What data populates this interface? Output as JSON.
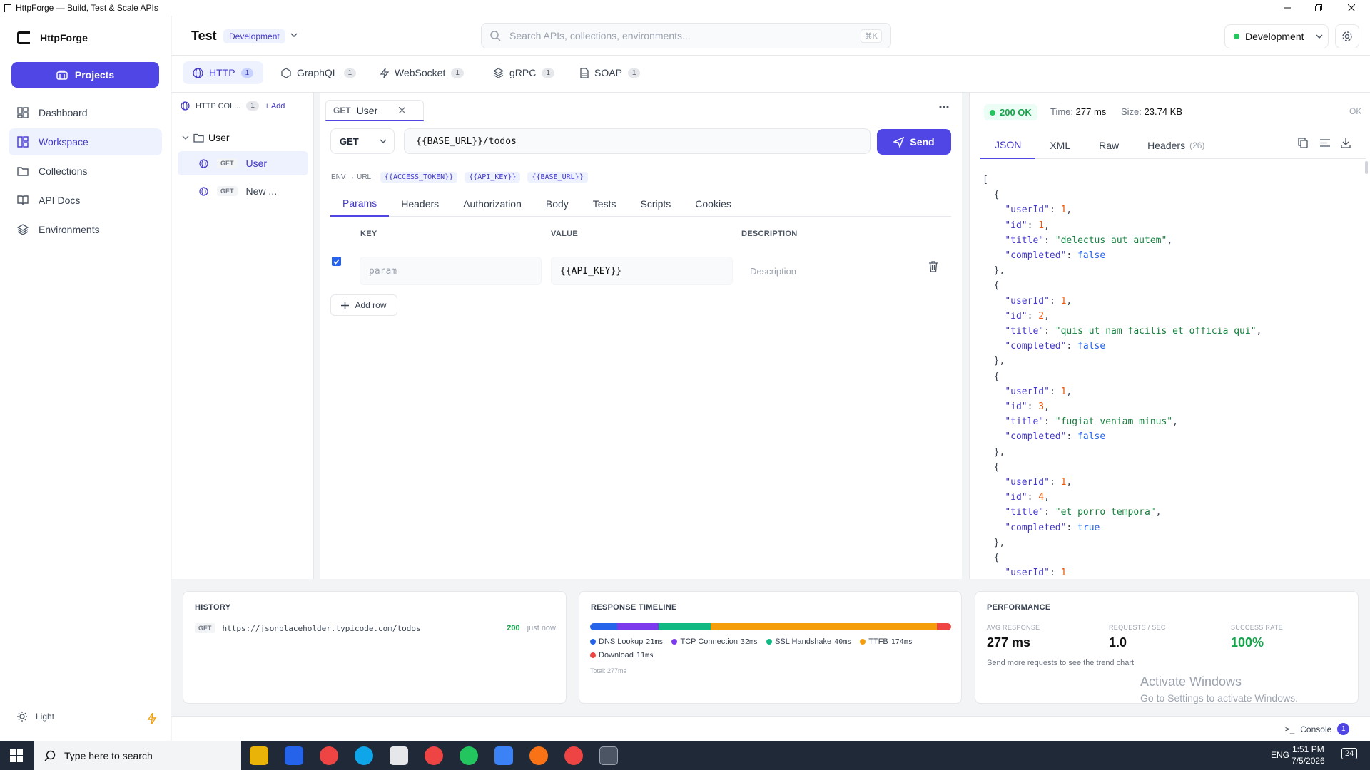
{
  "window": {
    "title": "HttpForge — Build, Test & Scale APIs"
  },
  "sidebar": {
    "brand": "HttpForge",
    "projects_label": "Projects",
    "items": [
      {
        "label": "Dashboard",
        "icon": "dashboard-icon"
      },
      {
        "label": "Workspace",
        "icon": "workspace-icon",
        "active": true
      },
      {
        "label": "Collections",
        "icon": "folder-icon"
      },
      {
        "label": "API Docs",
        "icon": "book-icon"
      },
      {
        "label": "Environments",
        "icon": "layers-icon"
      }
    ],
    "theme_label": "Light"
  },
  "header": {
    "project": "Test",
    "env_badge": "Development",
    "search_placeholder": "Search APIs, collections, environments...",
    "search_shortcut": "⌘K",
    "env_select": "Development"
  },
  "protocol_tabs": [
    {
      "label": "HTTP",
      "count": "1",
      "active": true
    },
    {
      "label": "GraphQL",
      "count": "1"
    },
    {
      "label": "WebSocket",
      "count": "1"
    },
    {
      "label": "gRPC",
      "count": "1"
    },
    {
      "label": "SOAP",
      "count": "1"
    }
  ],
  "collections": {
    "header": "HTTP COL...",
    "count": "1",
    "add_label": "Add",
    "folder": "User",
    "requests": [
      {
        "method": "GET",
        "name": "User",
        "active": true
      },
      {
        "method": "GET",
        "name": "New ..."
      }
    ]
  },
  "request": {
    "tab_method": "GET",
    "tab_name": "User",
    "method": "GET",
    "url": "{{BASE_URL}}/todos",
    "send_label": "Send",
    "env_label": "ENV → URL:",
    "env_chips": [
      "{{ACCESS_TOKEN}}",
      "{{API_KEY}}",
      "{{BASE_URL}}"
    ],
    "subtabs": [
      "Params",
      "Headers",
      "Authorization",
      "Body",
      "Tests",
      "Scripts",
      "Cookies"
    ],
    "params_columns": [
      "KEY",
      "VALUE",
      "DESCRIPTION"
    ],
    "param_row": {
      "key_placeholder": "param",
      "value": "{{API_KEY}}",
      "description_placeholder": "Description",
      "checked": true
    },
    "add_row_label": "Add row"
  },
  "response": {
    "status": "200 OK",
    "time_label": "Time:",
    "time": "277 ms",
    "size_label": "Size:",
    "size": "23.74 KB",
    "ok_label": "OK",
    "tabs": [
      "JSON",
      "XML",
      "Raw",
      "Headers"
    ],
    "headers_count": "(26)",
    "json_items": [
      {
        "userId": 1,
        "id": 1,
        "title": "delectus aut autem",
        "completed": false
      },
      {
        "userId": 1,
        "id": 2,
        "title": "quis ut nam facilis et officia qui",
        "completed": false
      },
      {
        "userId": 1,
        "id": 3,
        "title": "fugiat veniam minus",
        "completed": false
      },
      {
        "userId": 1,
        "id": 4,
        "title": "et porro tempora",
        "completed": true
      },
      {
        "userId": 1
      }
    ]
  },
  "history": {
    "title": "HISTORY",
    "items": [
      {
        "method": "GET",
        "url": "https://jsonplaceholder.typicode.com/todos",
        "status": "200",
        "when": "just now"
      }
    ]
  },
  "timeline": {
    "title": "RESPONSE TIMELINE",
    "phases": [
      {
        "name": "DNS Lookup",
        "value": "21ms",
        "ms": 21,
        "color": "#2563eb"
      },
      {
        "name": "TCP Connection",
        "value": "32ms",
        "ms": 32,
        "color": "#7c3aed"
      },
      {
        "name": "SSL Handshake",
        "value": "40ms",
        "ms": 40,
        "color": "#10b981"
      },
      {
        "name": "TTFB",
        "value": "174ms",
        "ms": 174,
        "color": "#f59e0b"
      },
      {
        "name": "Download",
        "value": "11ms",
        "ms": 11,
        "color": "#ef4444"
      }
    ],
    "total": "Total: 277ms"
  },
  "performance": {
    "title": "PERFORMANCE",
    "avg_label": "AVG RESPONSE",
    "avg": "277 ms",
    "rps_label": "REQUESTS / SEC",
    "rps": "1.0",
    "success_label": "SUCCESS RATE",
    "success": "100%",
    "hint": "Send more requests to see the trend chart"
  },
  "console": {
    "label": "Console",
    "count": "1"
  },
  "watermark": {
    "line1": "Activate Windows",
    "line2": "Go to Settings to activate Windows."
  },
  "taskbar": {
    "search_placeholder": "Type here to search",
    "time": "1:51 PM",
    "date": "7/5/2026",
    "lang": "ENG",
    "notifications": "24"
  }
}
